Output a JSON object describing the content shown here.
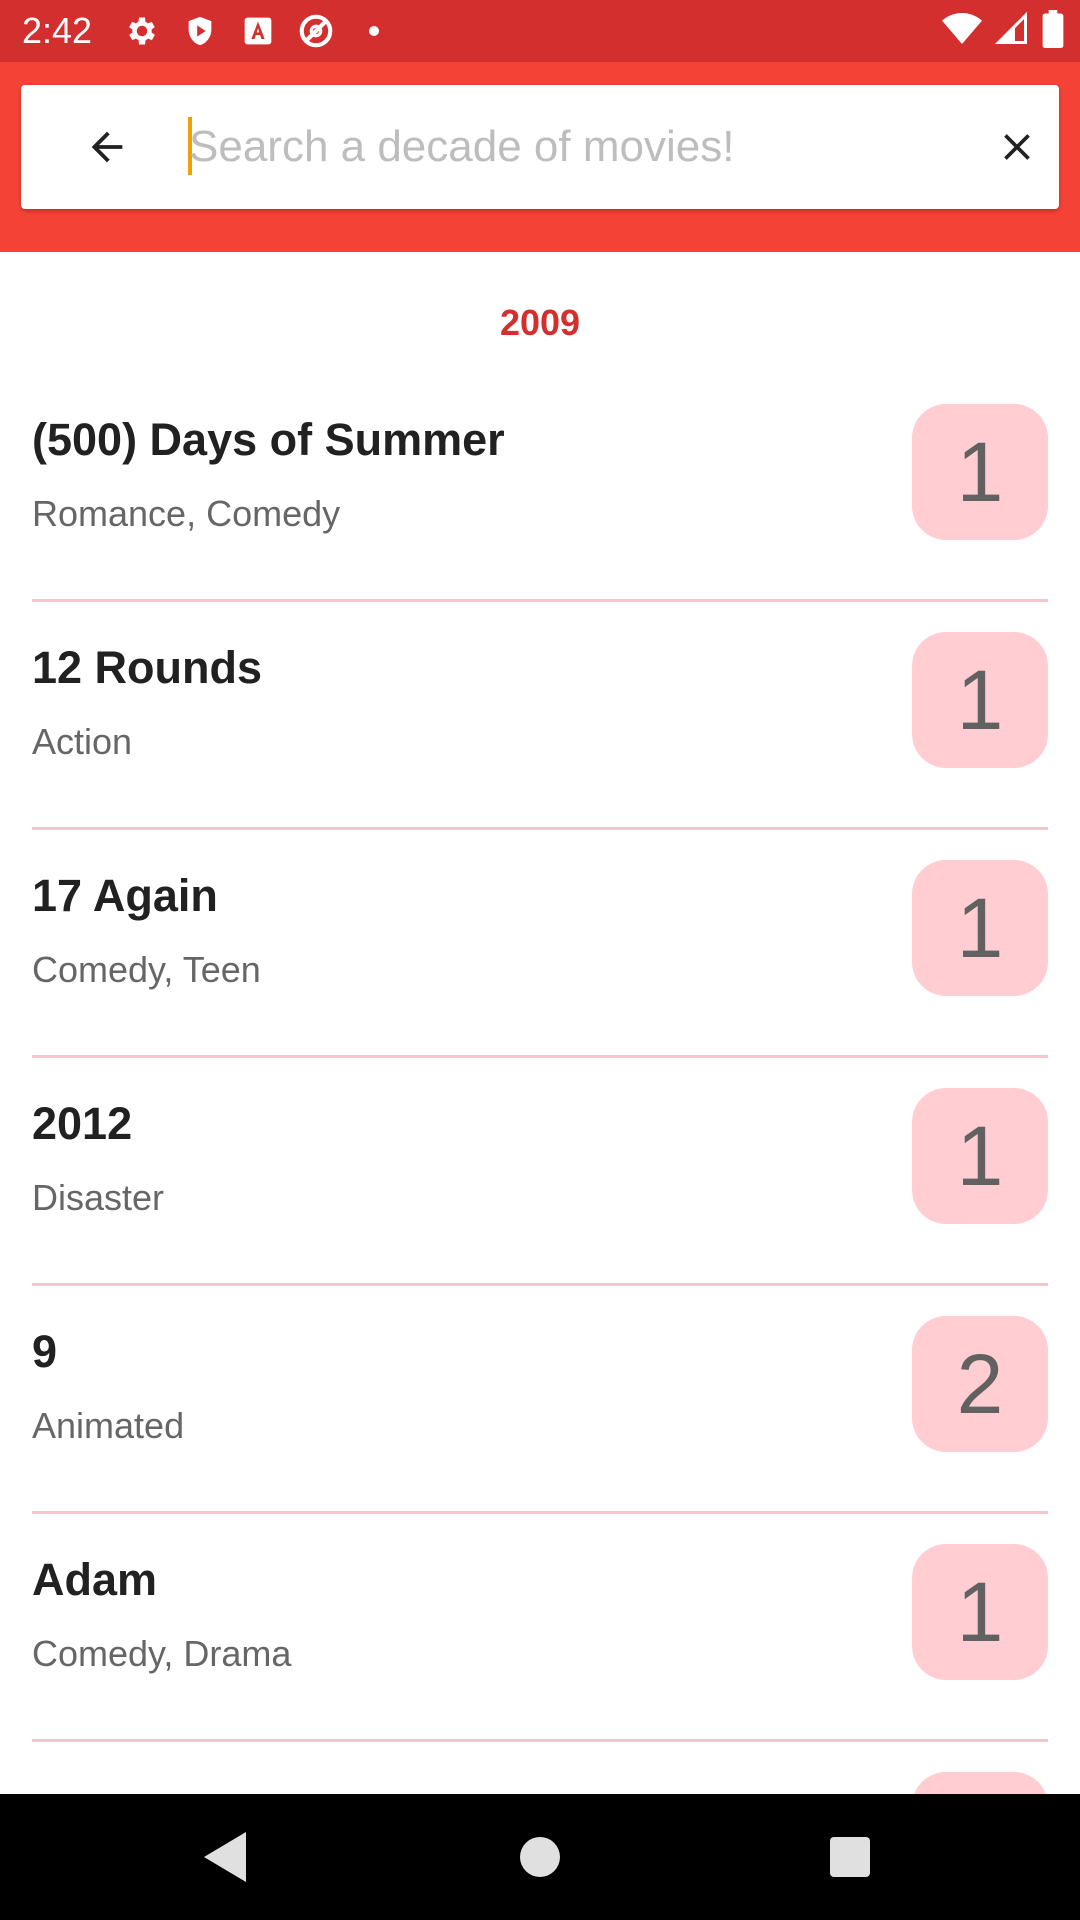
{
  "status_bar": {
    "time": "2:42",
    "left_icons": [
      "gear-icon",
      "shield-icon",
      "a-box-icon",
      "no-circle-icon",
      "dot-icon"
    ],
    "right_icons": [
      "wifi-icon",
      "signal-icon",
      "battery-icon"
    ]
  },
  "search": {
    "placeholder": "Search a decade of movies!",
    "value": ""
  },
  "section": {
    "year": "2009"
  },
  "movies": [
    {
      "title": "(500) Days of Summer",
      "genre": "Romance, Comedy",
      "count": "1"
    },
    {
      "title": "12 Rounds",
      "genre": "Action",
      "count": "1"
    },
    {
      "title": "17 Again",
      "genre": "Comedy, Teen",
      "count": "1"
    },
    {
      "title": "2012",
      "genre": "Disaster",
      "count": "1"
    },
    {
      "title": "9",
      "genre": "Animated",
      "count": "2"
    },
    {
      "title": "Adam",
      "genre": "Comedy, Drama",
      "count": "1"
    }
  ],
  "colors": {
    "status_bar": "#d32f2f",
    "app_bar": "#f44336",
    "accent": "#d32f2f",
    "badge": "#ffcdd2",
    "divider": "#f8c5cc"
  }
}
